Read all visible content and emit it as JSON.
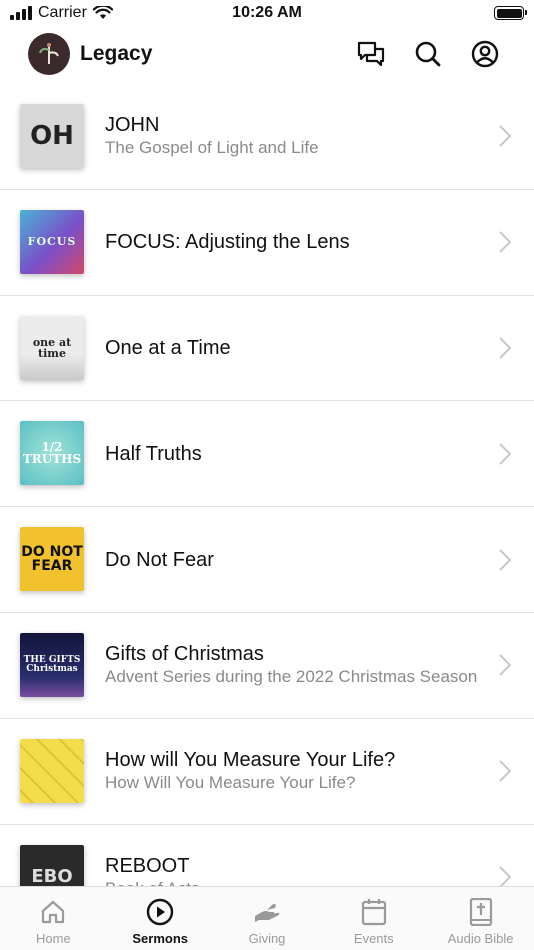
{
  "status_bar": {
    "carrier": "Carrier",
    "time": "10:26 AM"
  },
  "header": {
    "app_title": "Legacy",
    "icons": [
      "chat-icon",
      "search-icon",
      "account-icon"
    ]
  },
  "sermons": [
    {
      "title": "JOHN",
      "subtitle": "The Gospel of Light and Life",
      "thumb_text": "OH",
      "thumb_bg": "#d8d8d8",
      "thumb_fg": "#222222"
    },
    {
      "title": "FOCUS: Adjusting the Lens",
      "subtitle": "",
      "thumb_text": "FOCUS",
      "thumb_bg": "#6a5acd",
      "thumb_fg": "#e0ffe0"
    },
    {
      "title": "One at a Time",
      "subtitle": "",
      "thumb_text": "one at time",
      "thumb_bg": "#e6e6e6",
      "thumb_fg": "#222222"
    },
    {
      "title": "Half Truths",
      "subtitle": "",
      "thumb_text": "1/2 TRUTHS",
      "thumb_bg": "#7fd6d2",
      "thumb_fg": "#ffffff"
    },
    {
      "title": "Do Not Fear",
      "subtitle": "",
      "thumb_text": "DO NOT FEAR",
      "thumb_bg": "#f2c12e",
      "thumb_fg": "#111111"
    },
    {
      "title": "Gifts of Christmas",
      "subtitle": "Advent Series during the 2022 Christmas Season",
      "thumb_text": "THE GIFTS Christmas",
      "thumb_bg": "#1c1f4a",
      "thumb_fg": "#ffffff"
    },
    {
      "title": "How will You Measure Your Life?",
      "subtitle": "How Will You Measure Your Life?",
      "thumb_text": "",
      "thumb_bg": "#e8d44a",
      "thumb_fg": "#111111"
    },
    {
      "title": "REBOOT",
      "subtitle": "Book of Acts",
      "thumb_text": "EBO",
      "thumb_bg": "#2a2a2a",
      "thumb_fg": "#dddddd"
    }
  ],
  "tab_bar": [
    {
      "label": "Home",
      "icon": "home-icon",
      "active": false
    },
    {
      "label": "Sermons",
      "icon": "play-circle-icon",
      "active": true
    },
    {
      "label": "Giving",
      "icon": "giving-hand-icon",
      "active": false
    },
    {
      "label": "Events",
      "icon": "calendar-icon",
      "active": false
    },
    {
      "label": "Audio Bible",
      "icon": "bible-icon",
      "active": false
    }
  ],
  "colors": {
    "divider": "#e4e4e4",
    "subtitle": "#8a8a8a",
    "inactive_tab": "#9a9a9a",
    "active_tab": "#111111",
    "chevron": "#c7c7cc"
  }
}
